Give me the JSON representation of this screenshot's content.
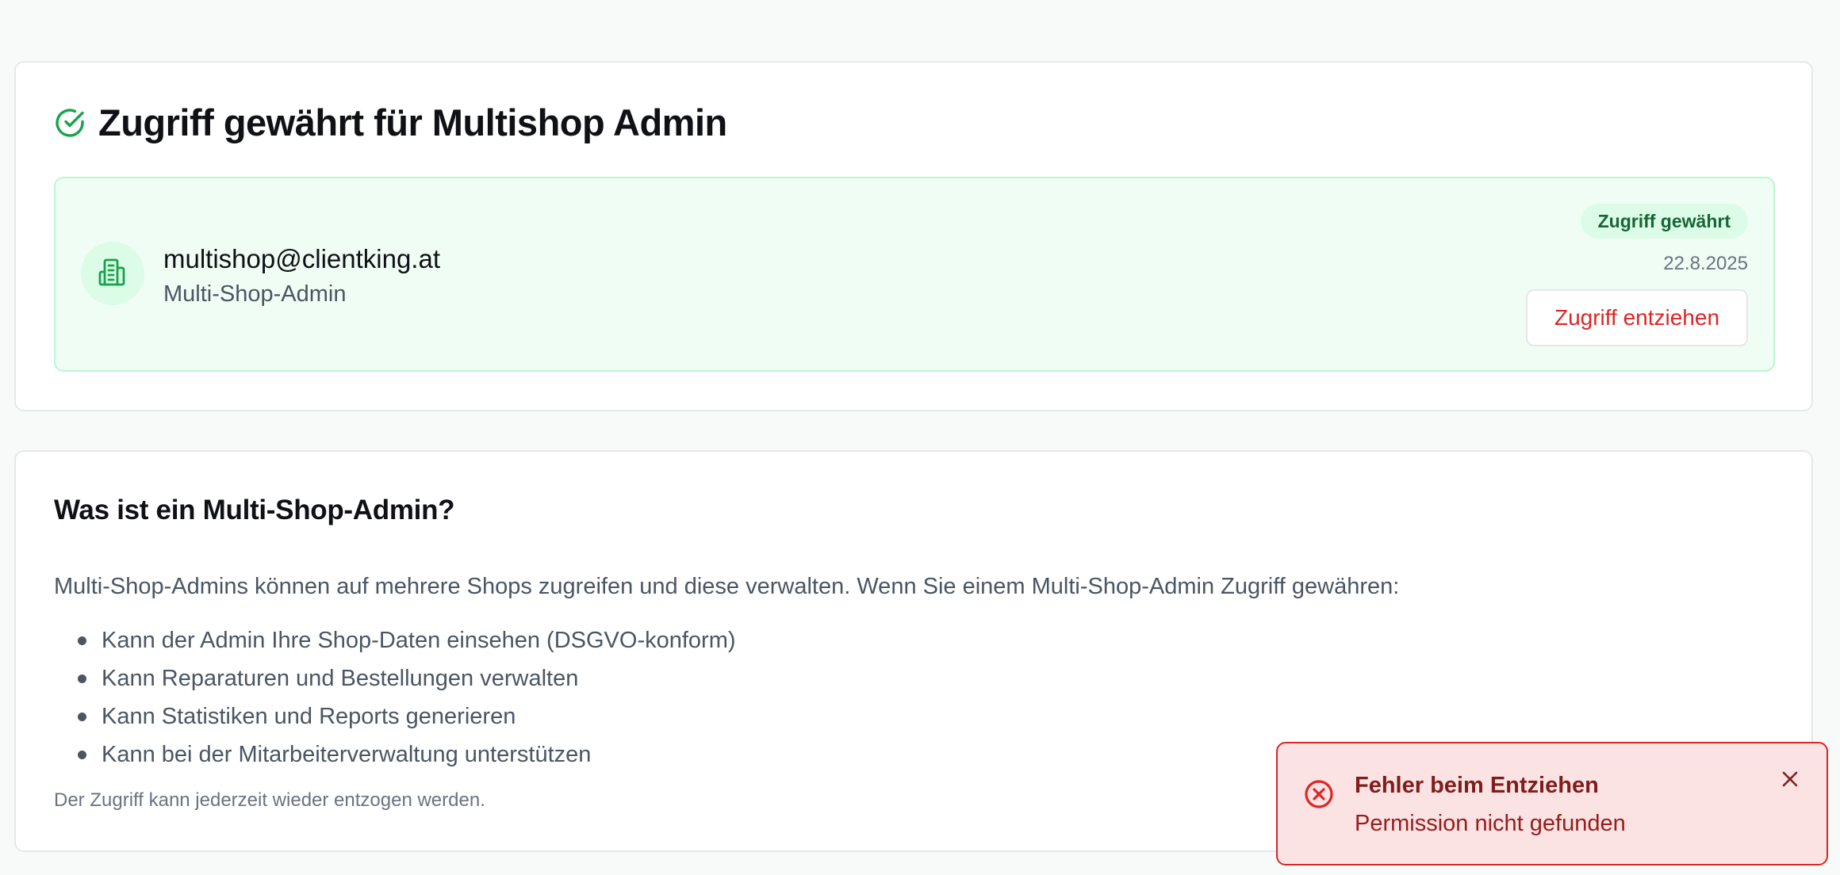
{
  "access_card": {
    "title": "Zugriff gewährt für Multishop Admin",
    "title_icon": "check-circle-icon",
    "user": {
      "avatar_icon": "building-icon",
      "email": "multishop@clientking.at",
      "role": "Multi-Shop-Admin"
    },
    "status_badge": "Zugriff gewährt",
    "date": "22.8.2025",
    "revoke_button_label": "Zugriff entziehen"
  },
  "info_card": {
    "title": "Was ist ein Multi-Shop-Admin?",
    "intro": "Multi-Shop-Admins können auf mehrere Shops zugreifen und diese verwalten. Wenn Sie einem Multi-Shop-Admin Zugriff gewähren:",
    "items": [
      "Kann der Admin Ihre Shop-Daten einsehen (DSGVO-konform)",
      "Kann Reparaturen und Bestellungen verwalten",
      "Kann Statistiken und Reports generieren",
      "Kann bei der Mitarbeiterverwaltung unterstützen"
    ],
    "note": "Der Zugriff kann jederzeit wieder entzogen werden."
  },
  "toast": {
    "icon": "x-circle-icon",
    "title": "Fehler beim Entziehen",
    "message": "Permission nicht gefunden",
    "close_icon": "close-icon"
  },
  "colors": {
    "page_background": "#f8faf9",
    "success_green": "#16a34a",
    "success_bg": "#f0fdf4",
    "danger_red": "#dc2626",
    "toast_bg": "#fbe3e3"
  }
}
